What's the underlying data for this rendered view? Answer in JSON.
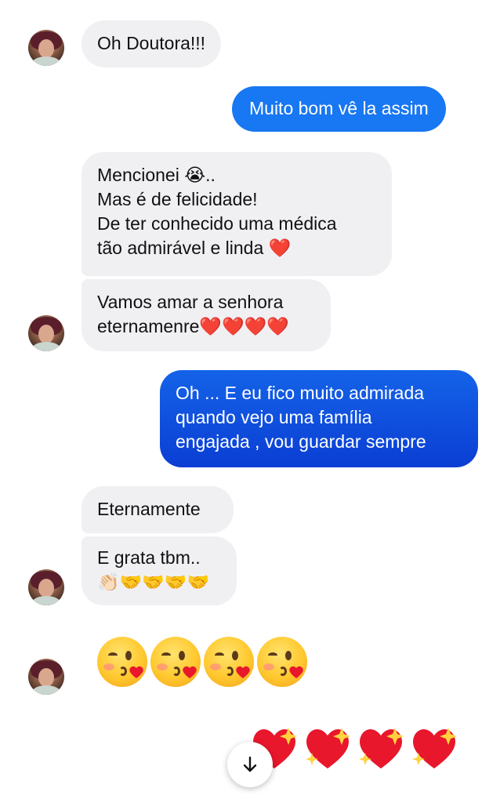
{
  "messages": [
    {
      "id": "m1",
      "side": "in",
      "text": "Oh Doutora!!!"
    },
    {
      "id": "m2",
      "side": "out",
      "text": "Muito bom vê la assim"
    },
    {
      "id": "m3",
      "side": "in",
      "text": "Mencionei 😭..\nMas é de felicidade!\nDe ter conhecido uma médica\ntão  admirável e linda ❤️"
    },
    {
      "id": "m4",
      "side": "in",
      "text": "Vamos amar a senhora\neternamenre❤️❤️❤️❤️"
    },
    {
      "id": "m5",
      "side": "out",
      "text": "Oh ... E eu fico muito admirada\nquando vejo uma família\nengajada , vou guardar sempre"
    },
    {
      "id": "m6",
      "side": "in",
      "text": "Eternamente"
    },
    {
      "id": "m7",
      "side": "in",
      "text": "E grata tbm..\n👏🏻🤝🤝🤝🤝"
    },
    {
      "id": "m8",
      "side": "in",
      "emoji": [
        "face-blowing-kiss",
        "face-blowing-kiss",
        "face-blowing-kiss",
        "face-blowing-kiss"
      ]
    },
    {
      "id": "m9",
      "side": "out",
      "emoji": [
        "sparkling-heart",
        "sparkling-heart",
        "sparkling-heart",
        "sparkling-heart"
      ]
    }
  ],
  "colors": {
    "incoming_bubble": "#f0f0f3",
    "outgoing_top": "#1877f2",
    "outgoing_bottom": "#0a3fd6",
    "heart": "#e8172b"
  },
  "icons": {
    "scroll_down": "arrow-down-icon"
  }
}
